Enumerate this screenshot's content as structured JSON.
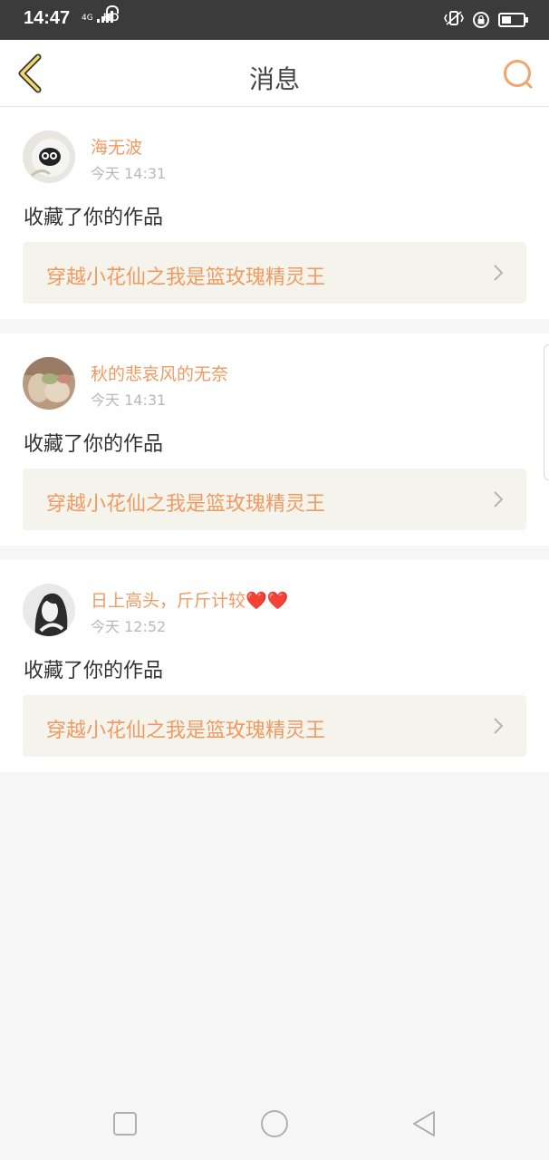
{
  "status_bar": {
    "time": "14:47",
    "network": "4G",
    "hd": "HD",
    "icons": [
      "signal-icon",
      "hd-call-icon",
      "vibrate-icon",
      "rotation-lock-icon",
      "battery-icon"
    ]
  },
  "header": {
    "title": "消息",
    "back_icon": "chevron-left-icon",
    "search_icon": "search-icon",
    "accent_color": "#f0a56a"
  },
  "messages": [
    {
      "user": "海无波",
      "time": "今天 14:31",
      "action": "收藏了你的作品",
      "work_title": "穿越小花仙之我是篮玫瑰精灵王"
    },
    {
      "user": "秋的悲哀风的无奈",
      "time": "今天 14:31",
      "action": "收藏了你的作品",
      "work_title": "穿越小花仙之我是篮玫瑰精灵王"
    },
    {
      "user": "日上高头，斤斤计较❤️❤️",
      "time": "今天 12:52",
      "action": "收藏了你的作品",
      "work_title": "穿越小花仙之我是篮玫瑰精灵王"
    }
  ],
  "nav_bar": {
    "icons": [
      "recents-square-icon",
      "home-circle-icon",
      "back-triangle-icon"
    ]
  }
}
